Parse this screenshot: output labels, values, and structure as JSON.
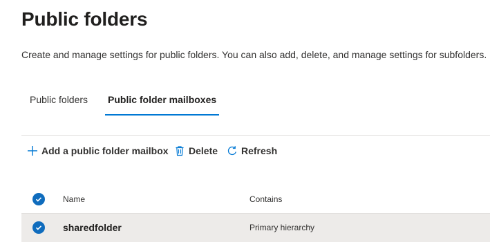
{
  "page": {
    "title": "Public folders",
    "description": "Create and manage settings for public folders. You can also add, delete, and manage settings for subfolders.",
    "learn_more_fragment": "L"
  },
  "tabs": [
    {
      "label": "Public folders",
      "selected": false
    },
    {
      "label": "Public folder mailboxes",
      "selected": true
    }
  ],
  "toolbar": {
    "add_label": "Add a public folder mailbox",
    "delete_label": "Delete",
    "refresh_label": "Refresh"
  },
  "table": {
    "columns": [
      "Name",
      "Contains"
    ],
    "rows": [
      {
        "name": "sharedfolder",
        "contains": "Primary hierarchy",
        "selected": true
      }
    ]
  },
  "colors": {
    "accent": "#0078d4",
    "checkbox": "#0f6cbd",
    "selected_row": "#edebe9"
  }
}
